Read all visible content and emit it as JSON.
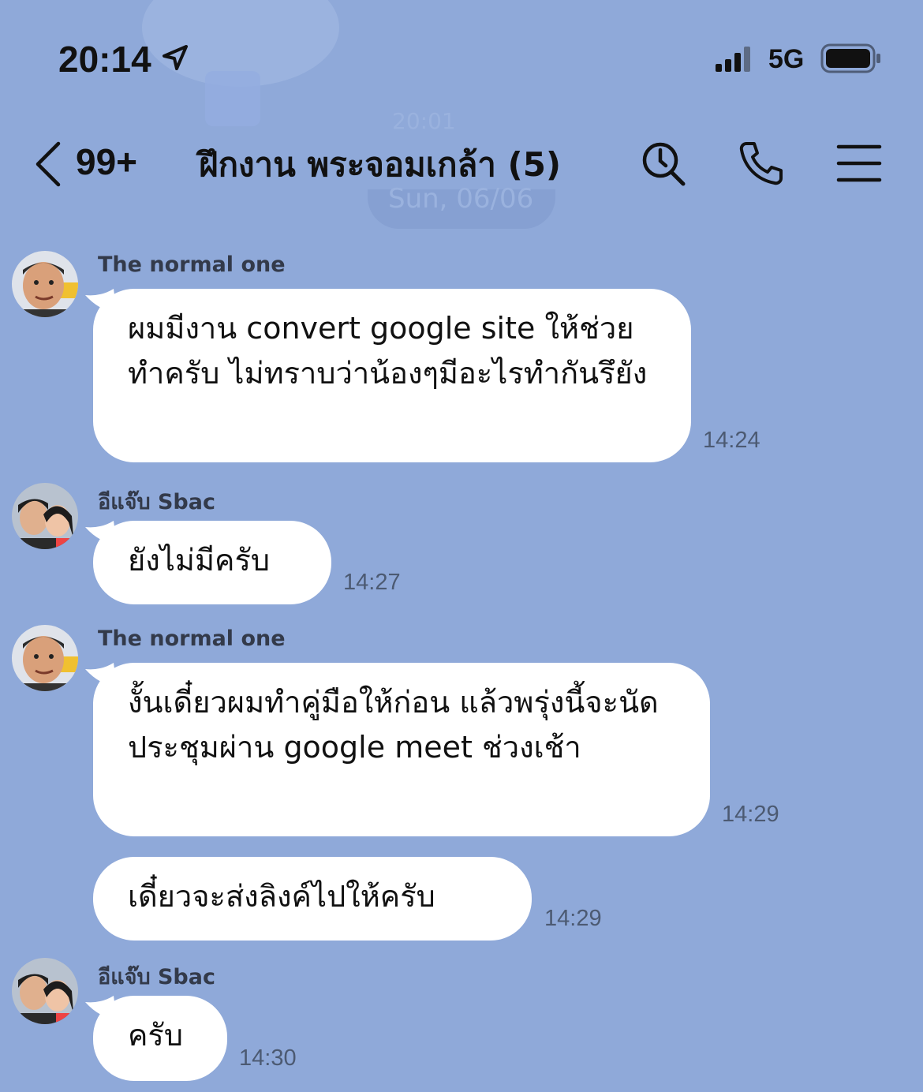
{
  "status_bar": {
    "time": "20:14",
    "network": "5G",
    "icons": [
      "location-arrow-icon",
      "signal-icon",
      "battery-icon"
    ]
  },
  "background": {
    "time": "20:01",
    "date": "Sun, 06/06"
  },
  "header": {
    "unread_count": "99+",
    "title": "ฝึกงาน พระจอมเกล้า (5)",
    "icons": [
      "back-icon",
      "search-icon",
      "phone-icon",
      "menu-icon"
    ]
  },
  "messages": [
    {
      "sender": "The normal one",
      "text": "ผมมีงาน convert google site ให้ช่วยทำครับ ไม่ทราบว่าน้องๆมีอะไรทำกันรึยัง",
      "time": "14:24"
    },
    {
      "sender": "อีแจ๊บ Sbac",
      "text": "ยังไม่มีครับ",
      "time": "14:27"
    },
    {
      "sender": "The normal one",
      "text": "งั้นเดี๋ยวผมทำคู่มือให้ก่อน แล้วพรุ่งนี้จะนัดประชุมผ่าน google meet ช่วงเช้า",
      "time": "14:29"
    },
    {
      "sender": "",
      "text": "เดี๋ยวจะส่งลิงค์ไปให้ครับ",
      "time": "14:29"
    },
    {
      "sender": "อีแจ๊บ Sbac",
      "text": "ครับ",
      "time": "14:30"
    }
  ],
  "colors": {
    "background": "#8fa9d9",
    "bubble": "#ffffff",
    "text": "#111111"
  }
}
